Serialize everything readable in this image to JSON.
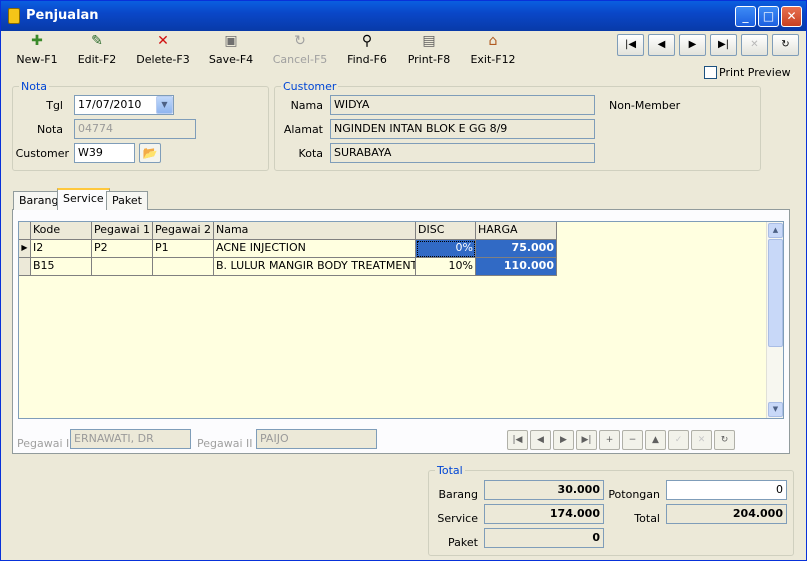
{
  "window": {
    "title": "Penjualan"
  },
  "toolbar": {
    "new": "New-F1",
    "edit": "Edit-F2",
    "delete": "Delete-F3",
    "save": "Save-F4",
    "cancel": "Cancel-F5",
    "find": "Find-F6",
    "print": "Print-F8",
    "exit": "Exit-F12"
  },
  "record_nav": {
    "first": "|◀",
    "prev": "◀",
    "next": "▶",
    "last": "▶|",
    "cancel": "✕",
    "refresh": "↻"
  },
  "print_preview": {
    "label": "Print Preview",
    "checked": false
  },
  "nota": {
    "title": "Nota",
    "tgl_label": "Tgl",
    "tgl_value": "17/07/2010",
    "nota_label": "Nota",
    "nota_value": "04774",
    "customer_label": "Customer",
    "customer_value": "W39"
  },
  "customer": {
    "title": "Customer",
    "nama_label": "Nama",
    "nama_value": "WIDYA",
    "alamat_label": "Alamat",
    "alamat_value": "NGINDEN INTAN BLOK E GG 8/9",
    "kota_label": "Kota",
    "kota_value": "SURABAYA",
    "member_status": "Non-Member"
  },
  "tabs": [
    "Barang",
    "Service",
    "Paket"
  ],
  "active_tab": "Service",
  "grid": {
    "columns": [
      "Kode",
      "Pegawai 1",
      "Pegawai 2",
      "Nama",
      "DISC",
      "HARGA"
    ],
    "rows": [
      {
        "kode": "I2",
        "pegawai1": "P2",
        "pegawai2": "P1",
        "nama": "ACNE INJECTION",
        "disc": "0%",
        "harga": "75.000"
      },
      {
        "kode": "B15",
        "pegawai1": "",
        "pegawai2": "",
        "nama": "B. LULUR MANGIR BODY TREATMENT",
        "disc": "10%",
        "harga": "110.000"
      }
    ]
  },
  "pegawai": {
    "p1_label": "Pegawai I",
    "p1_value": "ERNAWATI, DR",
    "p2_label": "Pegawai II",
    "p2_value": "PAIJO"
  },
  "db_nav": [
    "|◀",
    "◀",
    "▶",
    "▶|",
    "+",
    "−",
    "▲",
    "✓",
    "✕",
    "↻"
  ],
  "total": {
    "title": "Total",
    "barang_label": "Barang",
    "barang_value": "30.000",
    "service_label": "Service",
    "service_value": "174.000",
    "paket_label": "Paket",
    "paket_value": "0",
    "potongan_label": "Potongan",
    "potongan_value": "0",
    "total_label": "Total",
    "total_value": "204.000"
  },
  "colors": {
    "title_bar": "#0a47c8",
    "group_title": "#0046d5",
    "grid_bg": "#ffffe0",
    "selected_cell": "#316ac5"
  }
}
